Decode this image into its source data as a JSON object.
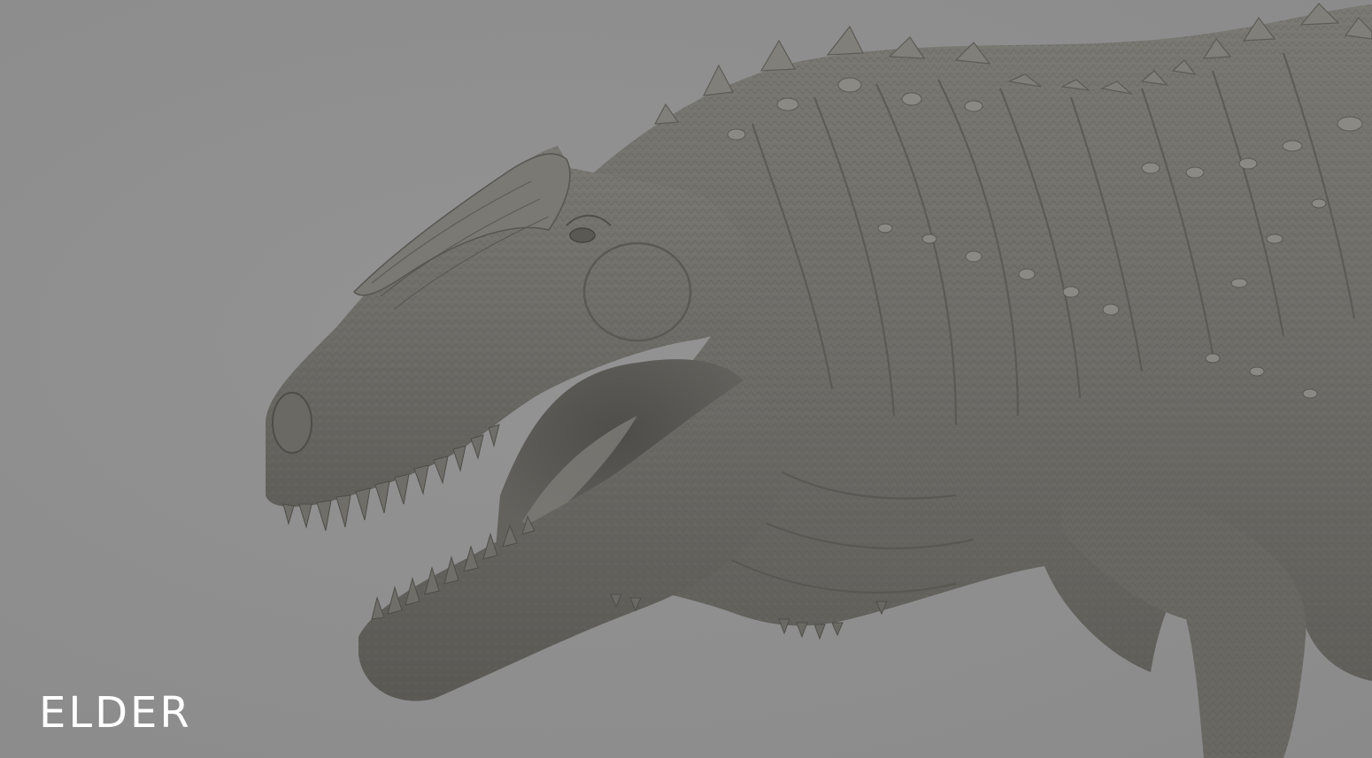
{
  "caption": {
    "text": "ELDER",
    "color": "#ffffff"
  },
  "scene": {
    "subject": "dinosaur-sculpt",
    "background_color": "#8f8f8f",
    "skin_color": "#6f6e69",
    "teeth_color": "#6a6964"
  }
}
